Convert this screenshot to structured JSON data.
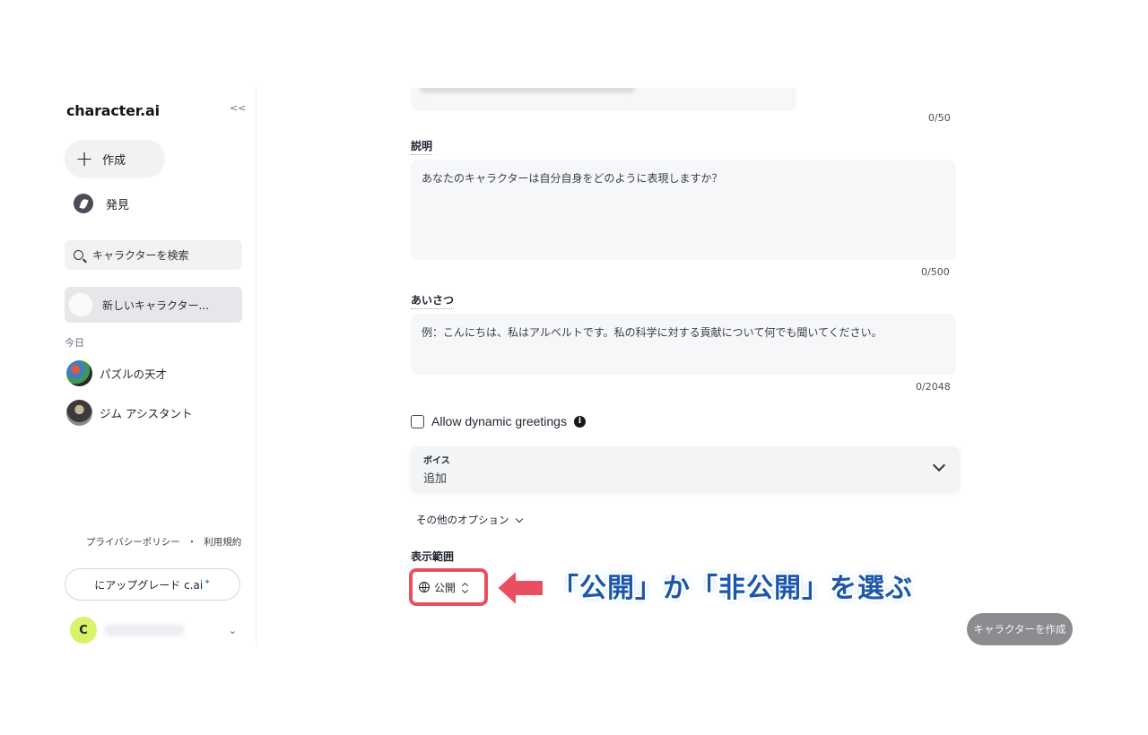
{
  "sidebar": {
    "logo": "character.ai",
    "collapse_label": "<<",
    "create_label": "作成",
    "discover_label": "発見",
    "search_placeholder": "キャラクターを検索",
    "new_character_label": "新しいキャラクター...",
    "section_today": "今日",
    "chats": [
      {
        "label": "パズルの天才",
        "icon": "puzzle-avatar"
      },
      {
        "label": "ジム アシスタント",
        "icon": "gym-avatar"
      }
    ],
    "legal": {
      "privacy": "プライバシーポリシー",
      "separator": "・",
      "terms": "利用規約"
    },
    "upgrade_label": "にアップグレード c.ai",
    "upgrade_spark": "✦",
    "user_initial": "C",
    "user_menu_chevron": "⌄"
  },
  "form": {
    "tagline_counter": "0/50",
    "description": {
      "label": "説明",
      "placeholder": "あなたのキャラクターは自分自身をどのように表現しますか？",
      "counter": "0/500"
    },
    "greeting": {
      "label": "あいさつ",
      "placeholder": "例：こんにちは、私はアルベルトです。私の科学に対する貢献について何でも聞いてください。",
      "counter": "0/2048"
    },
    "dynamic_greetings": {
      "label": "Allow dynamic greetings",
      "checked": false,
      "info_icon": "i"
    },
    "voice": {
      "label": "ボイス",
      "value": "追加"
    },
    "more_options_label": "その他のオプション",
    "visibility": {
      "label": "表示範囲",
      "value": "公開",
      "icon": "globe-icon"
    },
    "submit_label": "キャラクターを作成"
  },
  "annotation": {
    "callout_text": "「公開」か「非公開」を選ぶ",
    "highlight_color": "#ea4f5f",
    "text_color": "#1d57a8"
  },
  "colors": {
    "accent_fill": "#f1f2f4",
    "avatar_user": "#d8f26a",
    "submit_button": "#8a8c90"
  }
}
